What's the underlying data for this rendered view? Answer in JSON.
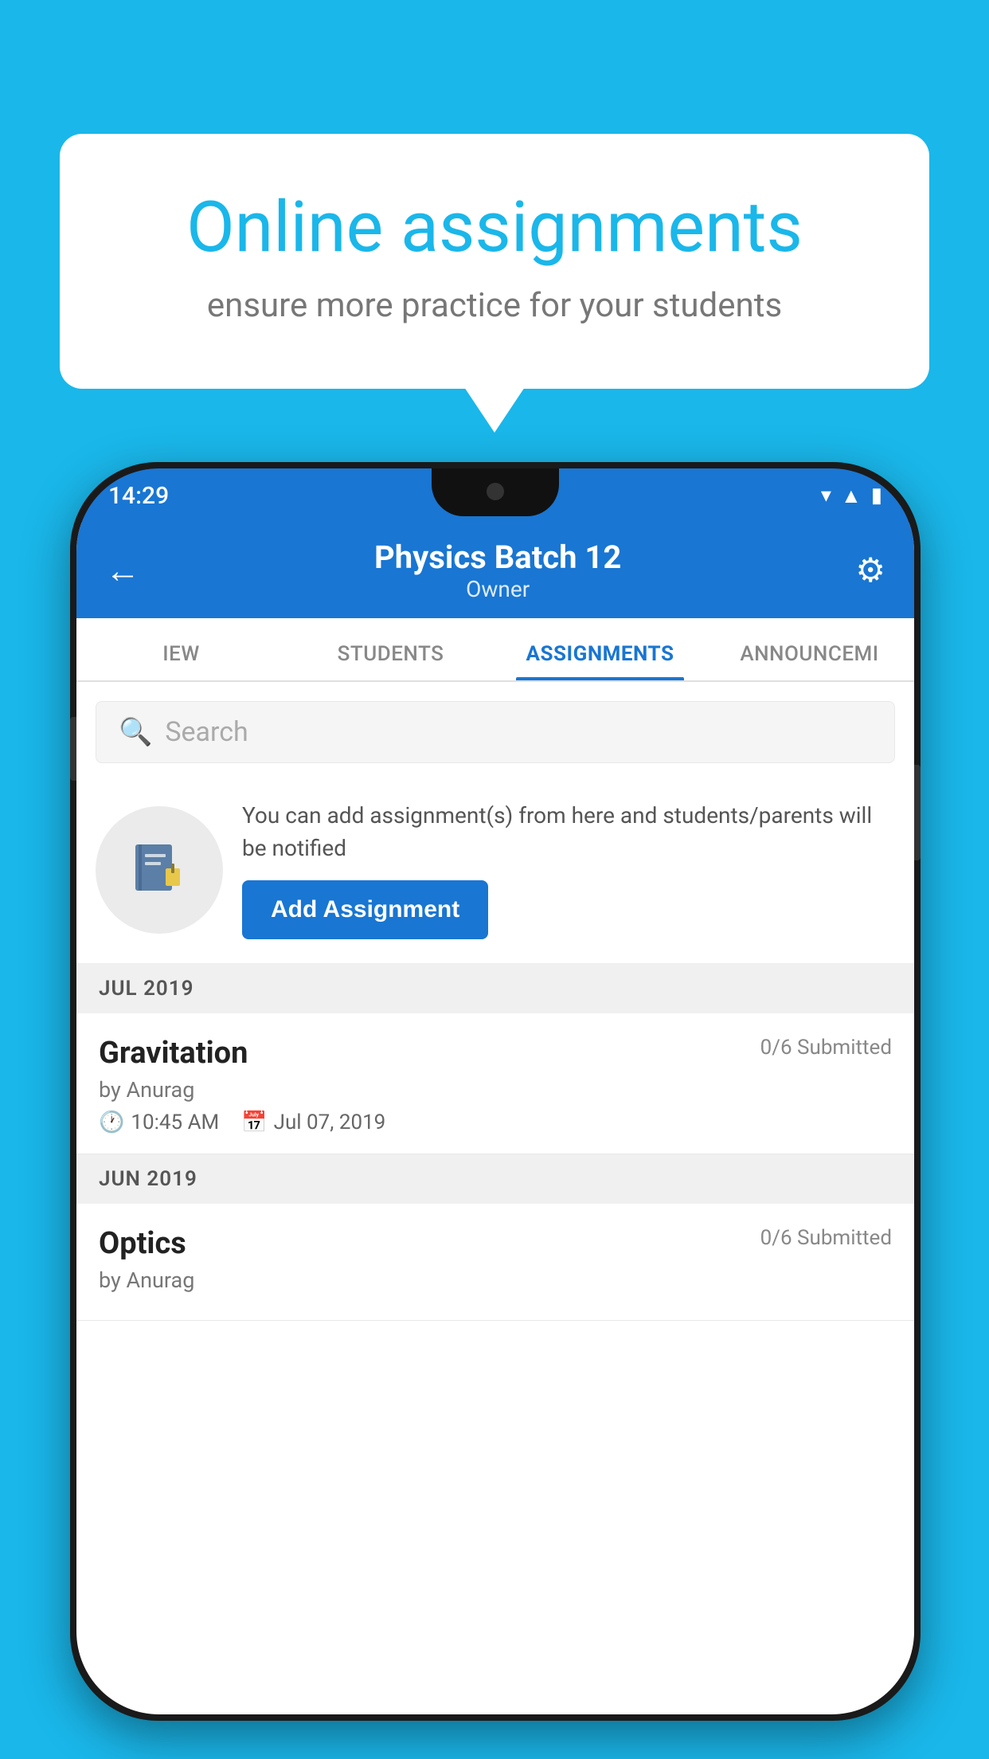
{
  "background_color": "#1ab7ea",
  "speech_bubble": {
    "title": "Online assignments",
    "subtitle": "ensure more practice for your students"
  },
  "phone": {
    "status_bar": {
      "time": "14:29",
      "icons": [
        "wifi",
        "signal",
        "battery"
      ]
    },
    "header": {
      "title": "Physics Batch 12",
      "subtitle": "Owner",
      "back_label": "←",
      "settings_label": "⚙"
    },
    "tabs": [
      {
        "label": "IEW",
        "active": false
      },
      {
        "label": "STUDENTS",
        "active": false
      },
      {
        "label": "ASSIGNMENTS",
        "active": true
      },
      {
        "label": "ANNOUNCEM…",
        "active": false
      }
    ],
    "search": {
      "placeholder": "Search"
    },
    "promo": {
      "text": "You can add assignment(s) from here and students/parents will be notified",
      "button_label": "Add Assignment"
    },
    "sections": [
      {
        "month_label": "JUL 2019",
        "assignments": [
          {
            "title": "Gravitation",
            "submitted": "0/6 Submitted",
            "by": "by Anurag",
            "time": "10:45 AM",
            "date": "Jul 07, 2019"
          }
        ]
      },
      {
        "month_label": "JUN 2019",
        "assignments": [
          {
            "title": "Optics",
            "submitted": "0/6 Submitted",
            "by": "by Anurag",
            "time": "",
            "date": ""
          }
        ]
      }
    ]
  }
}
